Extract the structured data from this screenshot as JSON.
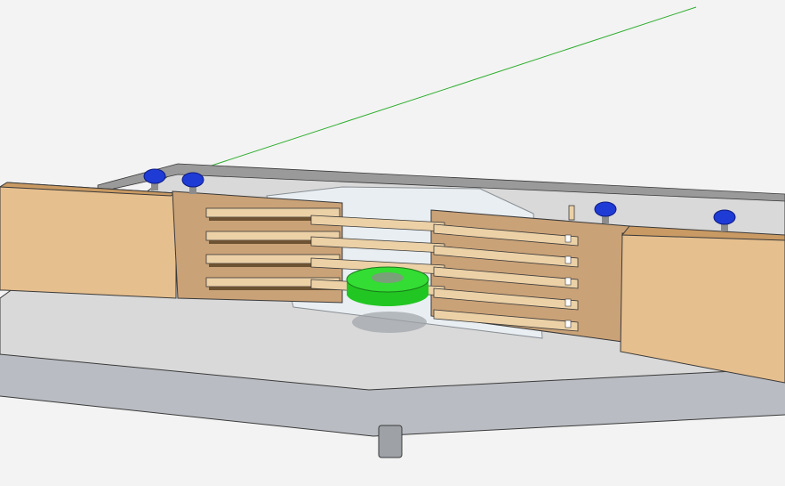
{
  "scene": {
    "description_visible_text": "",
    "colors": {
      "background": "#f3f3f3",
      "axis_green": "#2fae2f",
      "table_top": "#d9d9d9",
      "table_edge": "#a9adb3",
      "table_front": "#b9bcc2",
      "fence_wood": "#e6bf8e",
      "fence_wood_dark": "#c99a63",
      "fence_face": "#caa277",
      "slat_wood": "#ecd1a7",
      "knob_blue": "#1f3bd6",
      "cutter_green": "#33dd33",
      "shadow_gray": "#9ea3a8",
      "outline": "#3a3a3a"
    },
    "icons": [
      "knob-icon",
      "router-bit-icon"
    ]
  }
}
